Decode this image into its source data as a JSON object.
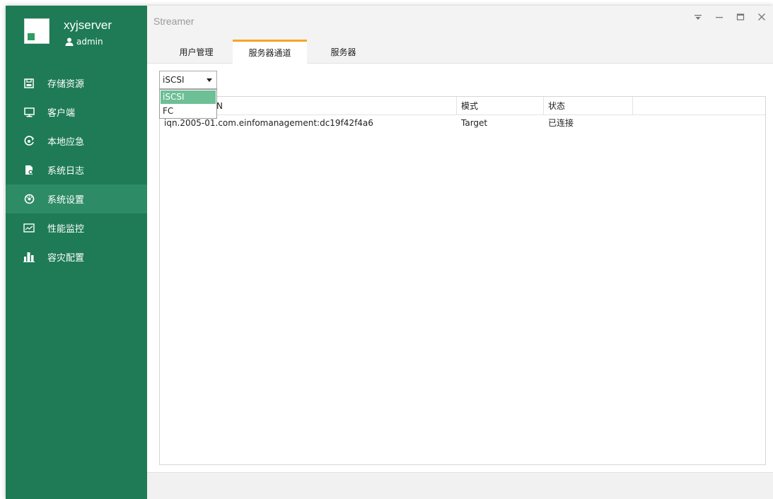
{
  "profile": {
    "server_name": "xyjserver",
    "user": "admin"
  },
  "sidebar": {
    "items": [
      {
        "label": "存储资源",
        "icon": "save-icon",
        "active": false
      },
      {
        "label": "客户端",
        "icon": "monitor-icon",
        "active": false
      },
      {
        "label": "本地应急",
        "icon": "emergency-icon",
        "active": false
      },
      {
        "label": "系统日志",
        "icon": "log-file-icon",
        "active": false
      },
      {
        "label": "系统设置",
        "icon": "settings-icon",
        "active": true
      },
      {
        "label": "性能监控",
        "icon": "chart-icon",
        "active": false
      },
      {
        "label": "容灾配置",
        "icon": "building-icon",
        "active": false
      }
    ]
  },
  "window": {
    "title": "Streamer"
  },
  "tabs": [
    {
      "label": "用户管理",
      "active": false
    },
    {
      "label": "服务器通道",
      "active": true
    },
    {
      "label": "服务器",
      "active": false
    }
  ],
  "select": {
    "value": "iSCSI",
    "options": [
      "iSCSI",
      "FC"
    ]
  },
  "table": {
    "columns": [
      "N",
      "模式",
      "状态",
      ""
    ],
    "rows": [
      [
        "iqn.2005-01.com.einfomanagement:dc19f42f4a6",
        "Target",
        "已连接",
        ""
      ]
    ]
  },
  "colors": {
    "sidebar_bg": "#1e7b56",
    "sidebar_active": "#2d8b66",
    "tab_accent": "#f5a623",
    "dropdown_selected": "#6dbf96"
  }
}
